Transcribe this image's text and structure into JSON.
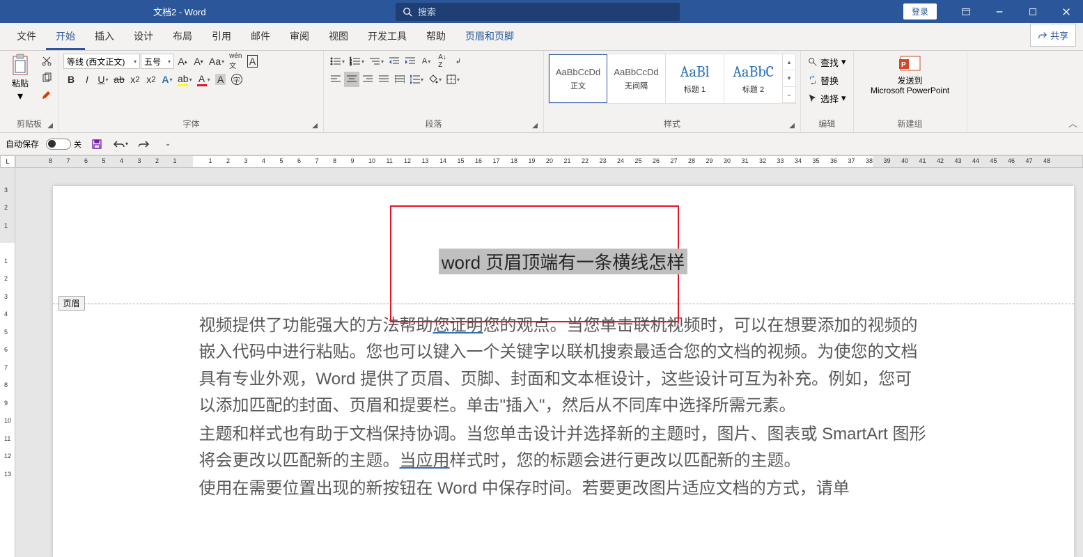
{
  "titlebar": {
    "doc_title": "文档2 - Word",
    "search_placeholder": "搜索",
    "login": "登录"
  },
  "tabs": {
    "items": [
      "文件",
      "开始",
      "插入",
      "设计",
      "布局",
      "引用",
      "邮件",
      "审阅",
      "视图",
      "开发工具",
      "帮助",
      "页眉和页脚"
    ],
    "active_index": 1,
    "context_index": 11,
    "share": "共享"
  },
  "ribbon": {
    "clipboard": {
      "paste": "粘贴",
      "label": "剪贴板"
    },
    "font": {
      "name": "等线 (西文正文)",
      "size": "五号",
      "label": "字体"
    },
    "paragraph": {
      "label": "段落"
    },
    "styles": {
      "label": "样式",
      "items": [
        {
          "preview": "AaBbCcDd",
          "name": "正文"
        },
        {
          "preview": "AaBbCcDd",
          "name": "无间隔"
        },
        {
          "preview": "AaBl",
          "name": "标题 1"
        },
        {
          "preview": "AaBbC",
          "name": "标题 2"
        }
      ]
    },
    "editing": {
      "find": "查找",
      "replace": "替换",
      "select": "选择",
      "label": "编辑"
    },
    "newgroup": {
      "line1": "发送到",
      "line2": "Microsoft PowerPoint",
      "label": "新建组"
    }
  },
  "qat": {
    "autosave": "自动保存",
    "autosave_state": "关"
  },
  "document": {
    "header_label": "页眉",
    "header_text": "word 页眉顶端有一条横线怎样",
    "body": {
      "p1": "视频提供了功能强大的方法帮助您证明您的观点。当您单击联机视频时，可以在想要添加的视频的嵌入代码中进行粘贴。您也可以键入一个关键字以联机搜索最适合您的文档的视频。为使您的文档具有专业外观，Word 提供了页眉、页脚、封面和文本框设计，这些设计可互为补充。例如，您可以添加匹配的封面、页眉和提要栏。单击\"插入\"，然后从不同库中选择所需元素。",
      "p1_ul": "您证明",
      "p2a": "主题和样式也有助于文档保持协调。当您单击设计并选择新的主题时，图片、图表或 SmartArt 图形将会更改以匹配新的主题。",
      "p2_ul": "当应用",
      "p2b": "样式时，您的标题会进行更改以匹配新的主题。",
      "p3": "使用在需要位置出现的新按钮在 Word 中保存时间。若要更改图片适应文档的方式，请单"
    }
  }
}
